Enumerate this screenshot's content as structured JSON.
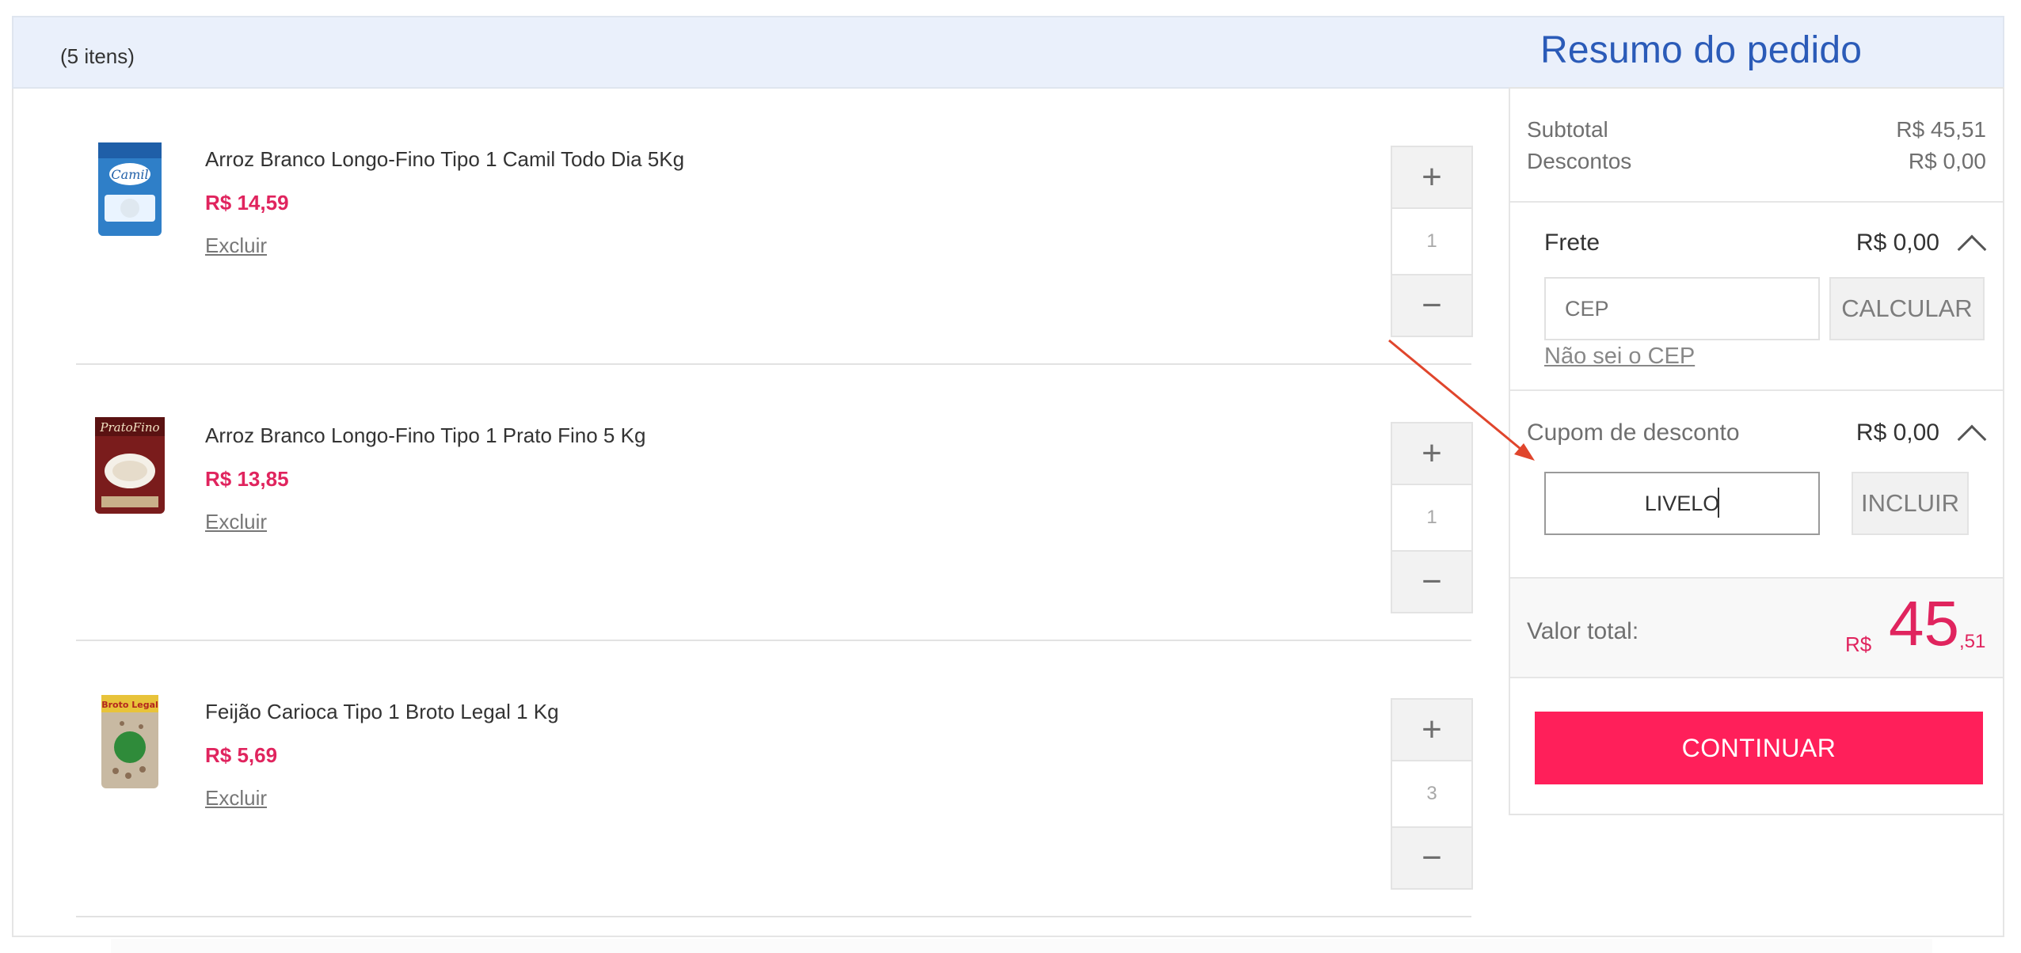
{
  "cart": {
    "items_count": "(5 itens)",
    "items": [
      {
        "name": "Arroz Branco Longo-Fino Tipo 1 Camil Todo Dia 5Kg",
        "price": "R$ 14,59",
        "remove_label": "Excluir",
        "quantity": "1",
        "plus": "+",
        "minus": "−",
        "image_label": "Camil",
        "colors": {
          "bag": "#2f7fc8",
          "accent": "#ffffff"
        }
      },
      {
        "name": "Arroz Branco Longo-Fino Tipo 1 Prato Fino 5 Kg",
        "price": "R$ 13,85",
        "remove_label": "Excluir",
        "quantity": "1",
        "plus": "+",
        "minus": "−",
        "image_label": "PratoFino",
        "colors": {
          "bag": "#7a1c1c",
          "accent": "#c9b08a"
        }
      },
      {
        "name": "Feijão Carioca Tipo 1 Broto Legal 1 Kg",
        "price": "R$ 5,69",
        "remove_label": "Excluir",
        "quantity": "3",
        "plus": "+",
        "minus": "−",
        "image_label": "Broto Legal",
        "colors": {
          "bag": "#c8b9a2",
          "accent": "#2f8b3a"
        }
      }
    ]
  },
  "summary": {
    "title": "Resumo do pedido",
    "subtotal_label": "Subtotal",
    "subtotal_value": "R$ 45,51",
    "discounts_label": "Descontos",
    "discounts_value": "R$ 0,00",
    "shipping": {
      "label": "Frete",
      "value": "R$ 0,00",
      "cep_placeholder": "CEP",
      "calculate_label": "CALCULAR",
      "unknown_cep_label": "Não sei o CEP"
    },
    "coupon": {
      "label": "Cupom de desconto",
      "value": "R$ 0,00",
      "input_value": "LIVELO",
      "apply_label": "INCLUIR"
    },
    "total": {
      "label": "Valor total:",
      "currency": "R$",
      "integer": "45",
      "cents": ",51"
    },
    "continue_label": "CONTINUAR"
  },
  "colors": {
    "price": "#e0245e",
    "title": "#2b5bb8",
    "continue_button": "#ff1f5a",
    "header_bg": "#eaf0fb",
    "arrow": "#e0452c"
  }
}
